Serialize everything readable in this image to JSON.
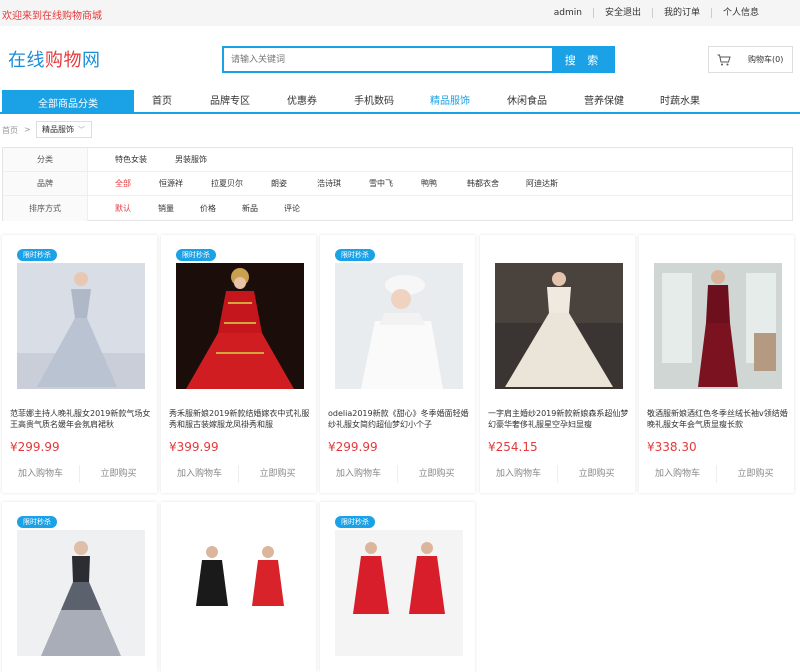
{
  "topbar": {
    "welcome": "欢迎来到在线购物商城",
    "links": [
      "admin",
      "安全退出",
      "我的订单",
      "个人信息"
    ]
  },
  "header": {
    "logo_a": "在线",
    "logo_b": "购物",
    "logo_c": "网",
    "search_placeholder": "请输入关键词",
    "search_button": "搜 索",
    "cart_label": "购物车(0)"
  },
  "nav": {
    "all": "全部商品分类",
    "items": [
      "首页",
      "品牌专区",
      "优惠券",
      "手机数码",
      "精品服饰",
      "休闲食品",
      "营养保健",
      "时蔬水果"
    ],
    "active": "精品服饰"
  },
  "breadcrumb": {
    "home": "首页",
    "sep": ">",
    "current": "精品服饰"
  },
  "filters": {
    "category": {
      "label": "分类",
      "options": [
        "特色女装",
        "男装服饰"
      ]
    },
    "brand": {
      "label": "品牌",
      "options": [
        "全部",
        "恒源祥",
        "拉夏贝尔",
        "朗姿",
        "浩诗琪",
        "雪中飞",
        "鸭鸭",
        "韩都衣舍",
        "阿迪达斯"
      ]
    },
    "sort": {
      "label": "排序方式",
      "options": [
        "默认",
        "销量",
        "价格",
        "新品",
        "评论"
      ]
    }
  },
  "products": [
    {
      "badge": "限时秒杀",
      "title": "范菲娜主持人晚礼服女2019新款气场女王高贵气质名媛年会氛肩裙秋",
      "price": "¥299.99"
    },
    {
      "badge": "限时秒杀",
      "title": "秀禾服新娘2019新款结婚嫁衣中式礼服秀和服古装嫁服龙凤褂秀和服",
      "price": "¥399.99"
    },
    {
      "badge": "限时秒杀",
      "title": "odelia2019新款《甜心》冬季婚面轻婚纱礼服女简约超仙梦幻小个子",
      "price": "¥299.99"
    },
    {
      "badge": "",
      "title": "一字肩主婚纱2019新款新娘森系超仙梦幻豪华奢侈礼服星空孕妇显瘦",
      "price": "¥254.15"
    },
    {
      "badge": "",
      "title": "敬酒服新娘酒红色冬季丝绒长袖v领结婚晚礼服女年会气质显瘦长款",
      "price": "¥338.30"
    },
    {
      "badge": "限时秒杀",
      "title": "",
      "price": ""
    },
    {
      "badge": "",
      "title": "",
      "price": ""
    },
    {
      "badge": "限时秒杀",
      "title": "",
      "price": ""
    }
  ],
  "card_actions": {
    "add": "加入购物车",
    "buy": "立即购买"
  },
  "colors": {
    "accent": "#1aa1e6",
    "price": "#e4393c"
  }
}
